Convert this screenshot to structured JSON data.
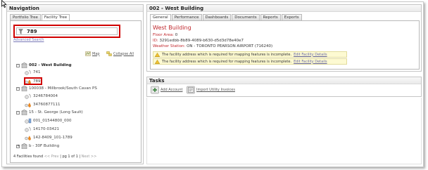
{
  "navigation": {
    "header": "Navigation",
    "tabs": [
      {
        "label": "Portfolio Tree"
      },
      {
        "label": "Facility Tree"
      }
    ],
    "search_value": "789",
    "advanced_search": "Advanced Search",
    "map_label": "Map",
    "collapse_all_label": "Collapse All",
    "tree": [
      {
        "label": "002 - West Building"
      },
      {
        "label": "741"
      },
      {
        "label": "789"
      },
      {
        "label": "100038 - Millbrook/South Cavan PS"
      },
      {
        "label": "3246784004"
      },
      {
        "label": "34760877111"
      },
      {
        "label": "15 - St. George (Long Sault)"
      },
      {
        "label": "001_01544800_000"
      },
      {
        "label": "14170-03421"
      },
      {
        "label": "142-8409_101-1789"
      },
      {
        "label": "b - 30F Building"
      }
    ],
    "footer": {
      "count": "4 Facilities found",
      "prev": "<< Prev",
      "page": "| pg 1 of 1 |",
      "next": "Next >>"
    }
  },
  "building": {
    "header": "002 - West Building",
    "tabs": [
      {
        "label": "General"
      },
      {
        "label": "Performance"
      },
      {
        "label": "Dashboards"
      },
      {
        "label": "Documents"
      },
      {
        "label": "Reports"
      },
      {
        "label": "Exports"
      }
    ],
    "title": "West Building",
    "floor_area_label": "Floor Area:",
    "floor_area_value": "0",
    "id_label": "ID:",
    "id_value": "3291edbb-8b89-4089-b630-d5d3d78e40e7",
    "weather_label": "Weather Station:",
    "weather_value": "ON - TORONTO PEARSON AIRPORT (716240)",
    "warnings": [
      {
        "text": "The facility address which is required for mapping features is incomplete.",
        "link": "Edit Facility Details"
      },
      {
        "text": "The facility address which is required for mapping features is incomplete.",
        "link": "Edit Facility Details"
      }
    ]
  },
  "tasks": {
    "header": "Tasks",
    "items": [
      {
        "label": "Add Account"
      },
      {
        "label": "Import Utility Invoices"
      }
    ]
  },
  "colors": {
    "accent_red": "#c0282d",
    "highlight_red": "#d00000",
    "warning_bg": "#fdfad2"
  }
}
